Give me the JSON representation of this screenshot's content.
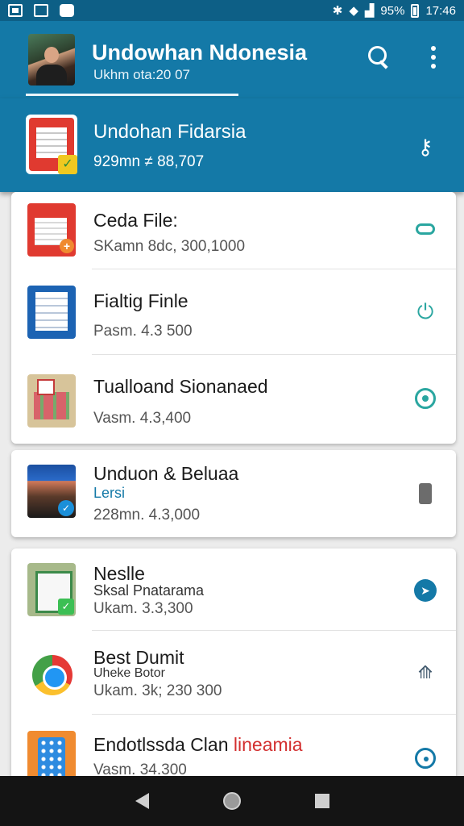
{
  "status_bar": {
    "battery": "95%",
    "time": "17:46"
  },
  "app_bar": {
    "title": "Undowhan Ndonesia",
    "subtitle": "Ukhm ota:20 07",
    "search_icon": "search-icon",
    "more_icon": "more-vert-icon"
  },
  "highlight": {
    "title": "Undohan Fidarsia",
    "meta": "929mn ≠ 88,707",
    "action_icon": "key-icon"
  },
  "card1": [
    {
      "name": "Ceda File:",
      "meta": "SKamn 8dc, 300,1000",
      "icon": "document-red-icon",
      "action": "sync-icon"
    },
    {
      "name": "Fialtig Finle",
      "meta": "Pasm. 4.3 500",
      "icon": "document-blue-icon",
      "action": "power-icon"
    },
    {
      "name": "Tualloand Sionanaed",
      "meta": "Vasm. 4.3,400",
      "icon": "calendar-icon",
      "action": "chat-icon"
    }
  ],
  "card2": {
    "name": "Unduon & Beluaa",
    "extra": "Lersi",
    "meta": "228mn. 4.3,000",
    "icon": "photo-thumbnail-icon",
    "action": "battery-icon"
  },
  "card3": [
    {
      "name": "Neslle",
      "extra": "Sksal Pnatarama",
      "meta": "Ukam. 3.3,300",
      "icon": "document-green-icon",
      "action": "send-icon"
    },
    {
      "name": "Best Dumit",
      "extra": "Uheke Botor",
      "meta": "Ukam. 3k; 230 300",
      "icon": "chrome-icon",
      "action": "navigation-icon"
    },
    {
      "name": "Endotlssda Clan",
      "name_accent": "lineamia",
      "meta": "Vasm. 34.300",
      "icon": "phone-apps-icon",
      "action": "clock-icon"
    }
  ],
  "colors": {
    "primary": "#1479a7",
    "accent": "#2aa6a0",
    "highlight_red": "#d32f2f"
  }
}
